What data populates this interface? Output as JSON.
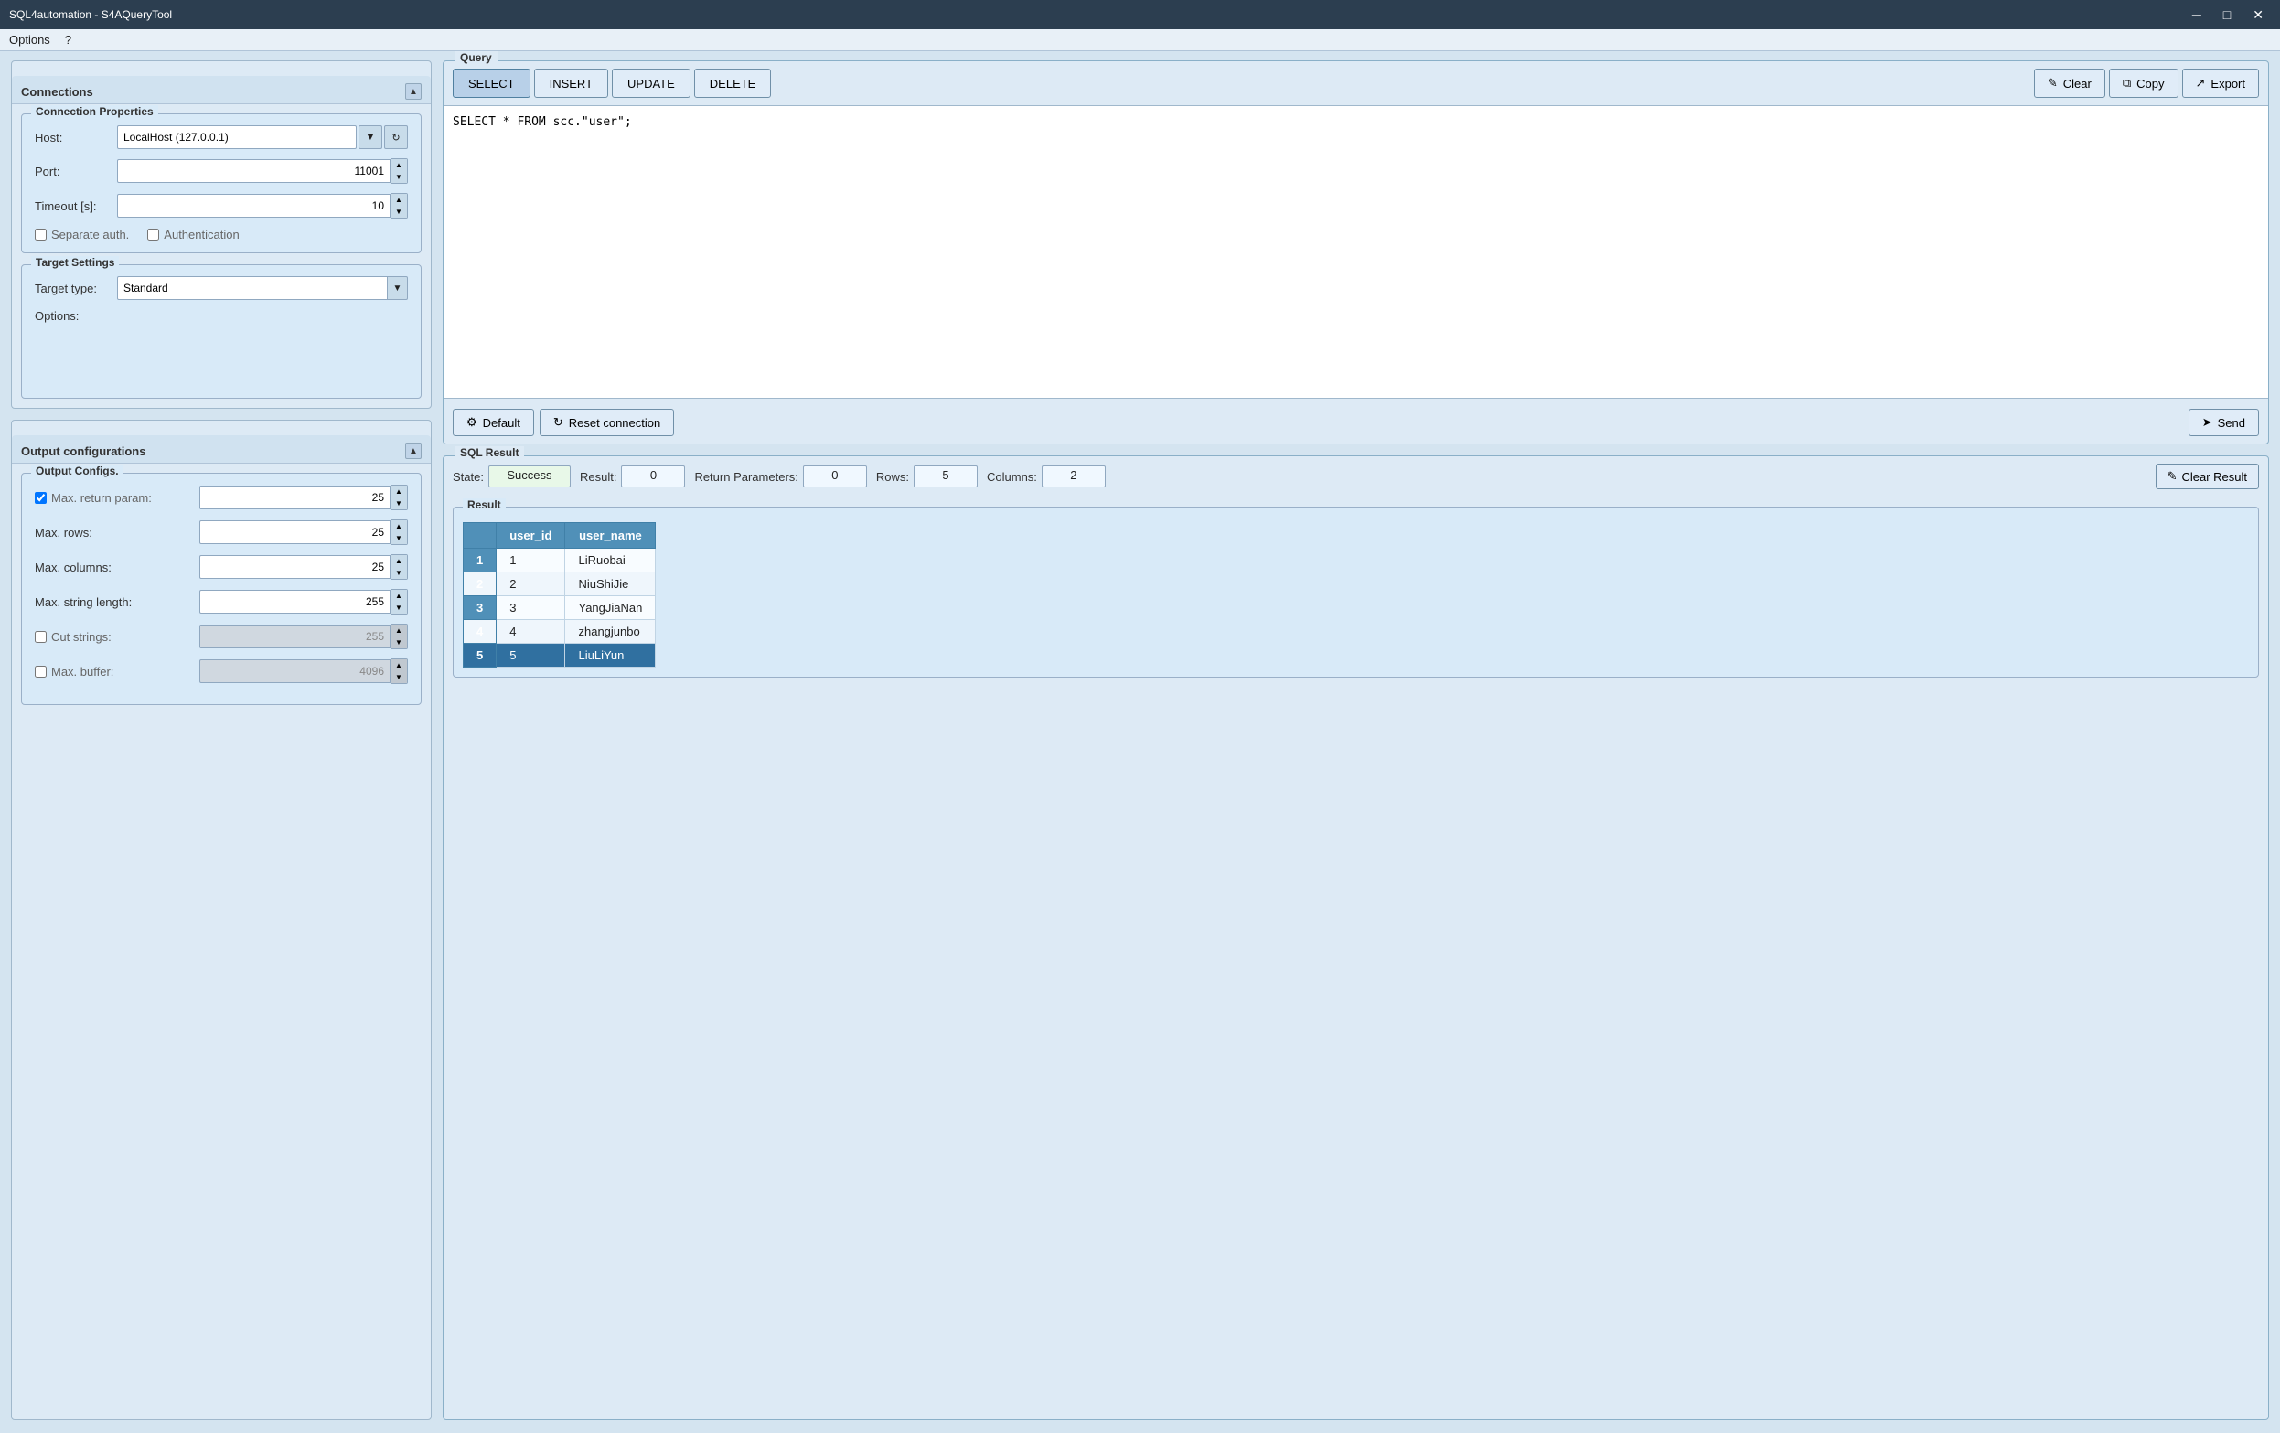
{
  "titleBar": {
    "title": "SQL4automation - S4AQueryTool",
    "minimize": "─",
    "maximize": "□",
    "close": "✕"
  },
  "menuBar": {
    "options": "Options",
    "help": "?"
  },
  "connections": {
    "panelTitle": "Connections",
    "connectionProperties": {
      "sectionTitle": "Connection Properties",
      "hostLabel": "Host:",
      "hostValue": "LocalHost (127.0.0.1)",
      "portLabel": "Port:",
      "portValue": "11001",
      "timeoutLabel": "Timeout [s]:",
      "timeoutValue": "10",
      "separateAuthLabel": "Separate auth.",
      "authLabel": "Authentication"
    },
    "targetSettings": {
      "sectionTitle": "Target Settings",
      "targetTypeLabel": "Target type:",
      "targetTypeValue": "Standard",
      "optionsLabel": "Options:"
    }
  },
  "outputConfigs": {
    "panelTitle": "Output configurations",
    "sectionTitle": "Output Configs.",
    "maxReturnParam": {
      "label": "Max. return param:",
      "checked": true,
      "value": "25"
    },
    "maxRows": {
      "label": "Max. rows:",
      "value": "25"
    },
    "maxColumns": {
      "label": "Max. columns:",
      "value": "25"
    },
    "maxStringLength": {
      "label": "Max. string length:",
      "value": "255"
    },
    "cutStrings": {
      "label": "Cut strings:",
      "checked": false,
      "value": "255"
    },
    "maxBuffer": {
      "label": "Max. buffer:",
      "checked": false,
      "value": "4096"
    }
  },
  "query": {
    "panelTitle": "Query",
    "buttons": {
      "select": "SELECT",
      "insert": "INSERT",
      "update": "UPDATE",
      "delete": "DELETE",
      "clear": "Clear",
      "copy": "Copy",
      "export": "Export",
      "default": "Default",
      "resetConnection": "Reset connection",
      "send": "Send"
    },
    "queryText": "SELECT * FROM scc.\"user\";"
  },
  "sqlResult": {
    "panelTitle": "SQL Result",
    "stateLabel": "State:",
    "stateValue": "Success",
    "resultLabel": "Result:",
    "resultValue": "0",
    "returnParamsLabel": "Return Parameters:",
    "returnParamsValue": "0",
    "rowsLabel": "Rows:",
    "rowsValue": "5",
    "columnsLabel": "Columns:",
    "columnsValue": "2",
    "clearResultBtn": "Clear Result",
    "resultTableTitle": "Result",
    "columns": [
      "user_id",
      "user_name"
    ],
    "rows": [
      {
        "num": "1",
        "user_id": "1",
        "user_name": "LiRuobai",
        "selected": false
      },
      {
        "num": "2",
        "user_id": "2",
        "user_name": "NiuShiJie",
        "selected": false
      },
      {
        "num": "3",
        "user_id": "3",
        "user_name": "YangJiaNan",
        "selected": false
      },
      {
        "num": "4",
        "user_id": "4",
        "user_name": "zhangjunbo",
        "selected": false
      },
      {
        "num": "5",
        "user_id": "5",
        "user_name": "LiuLiYun",
        "selected": true
      }
    ]
  }
}
